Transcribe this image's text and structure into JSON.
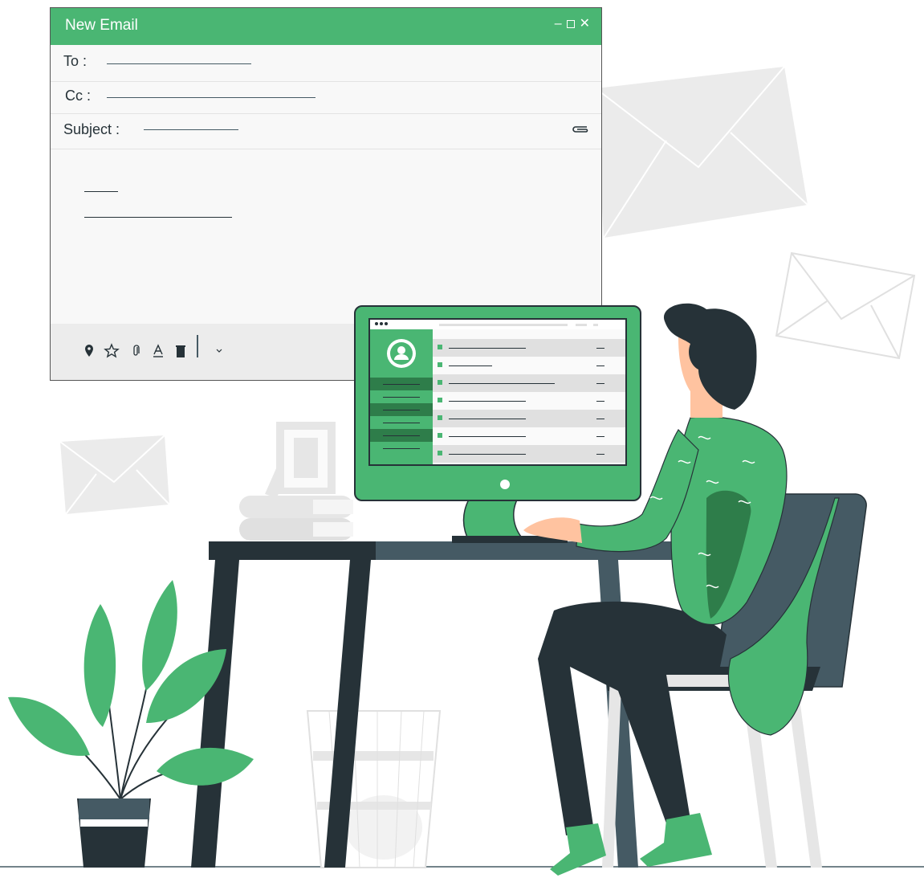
{
  "email": {
    "title": "New Email",
    "to_label": "To :",
    "cc_label": "Cc :",
    "subject_label": "Subject :",
    "controls": {
      "minimize": "–",
      "close": "✕"
    }
  },
  "colors": {
    "accent": "#4ab673",
    "dark_green": "#2e7d4a",
    "dark": "#263238",
    "slate": "#455a64",
    "light_gray": "#ececec"
  },
  "icons": [
    "location-pin-icon",
    "star-icon",
    "paperclip-icon",
    "font-color-icon",
    "trash-icon",
    "chevron-down-icon"
  ]
}
